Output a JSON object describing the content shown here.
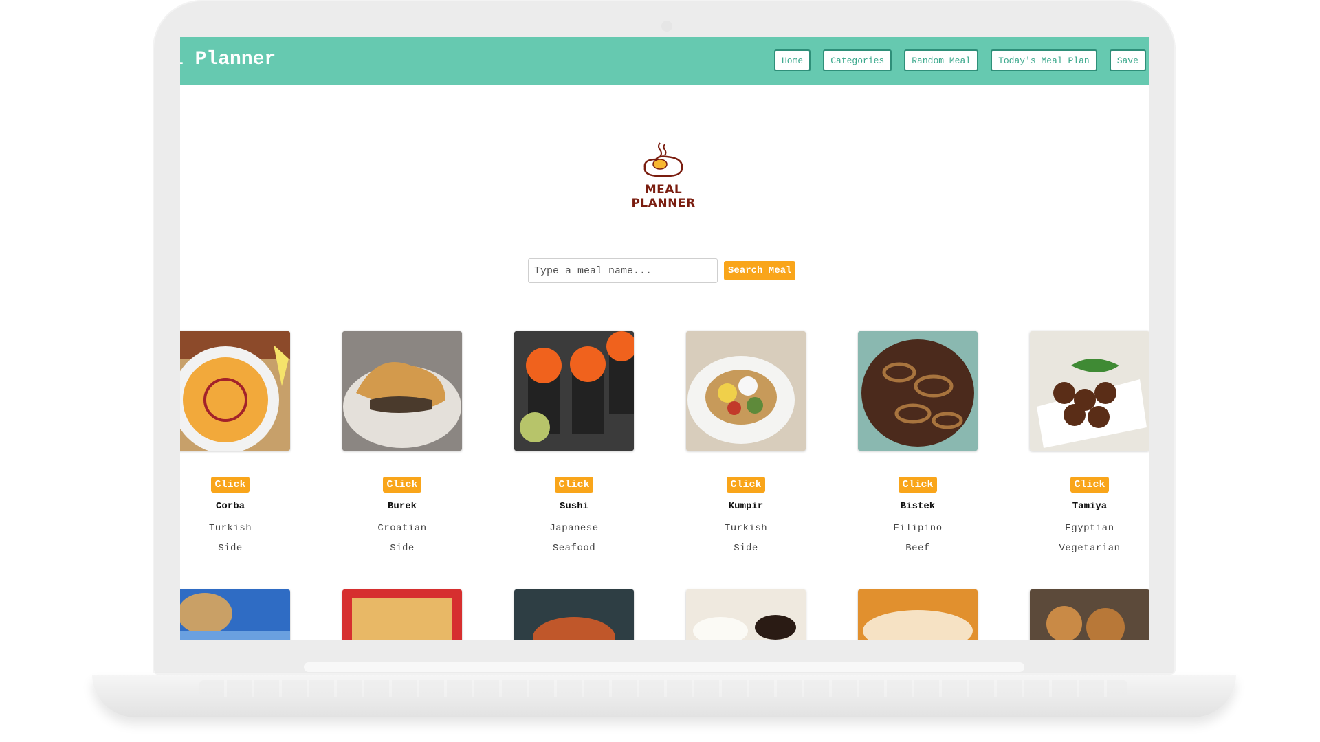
{
  "navbar": {
    "title": "l Planner",
    "links": [
      "Home",
      "Categories",
      "Random Meal",
      "Today's Meal Plan",
      "Save"
    ]
  },
  "logo": {
    "text": "MEAL PLANNER"
  },
  "search": {
    "placeholder": "Type a meal name...",
    "button_label": "Search Meal"
  },
  "meals": [
    {
      "name": "Corba",
      "area": "Turkish",
      "category": "Side",
      "button": "Click"
    },
    {
      "name": "Burek",
      "area": "Croatian",
      "category": "Side",
      "button": "Click"
    },
    {
      "name": "Sushi",
      "area": "Japanese",
      "category": "Seafood",
      "button": "Click"
    },
    {
      "name": "Kumpir",
      "area": "Turkish",
      "category": "Side",
      "button": "Click"
    },
    {
      "name": "Bistek",
      "area": "Filipino",
      "category": "Beef",
      "button": "Click"
    },
    {
      "name": "Tamiya",
      "area": "Egyptian",
      "category": "Vegetarian",
      "button": "Click"
    }
  ],
  "colors": {
    "navbar": "#66c9b0",
    "accent": "#f9a51a",
    "logo_text": "#7a1d0f"
  }
}
